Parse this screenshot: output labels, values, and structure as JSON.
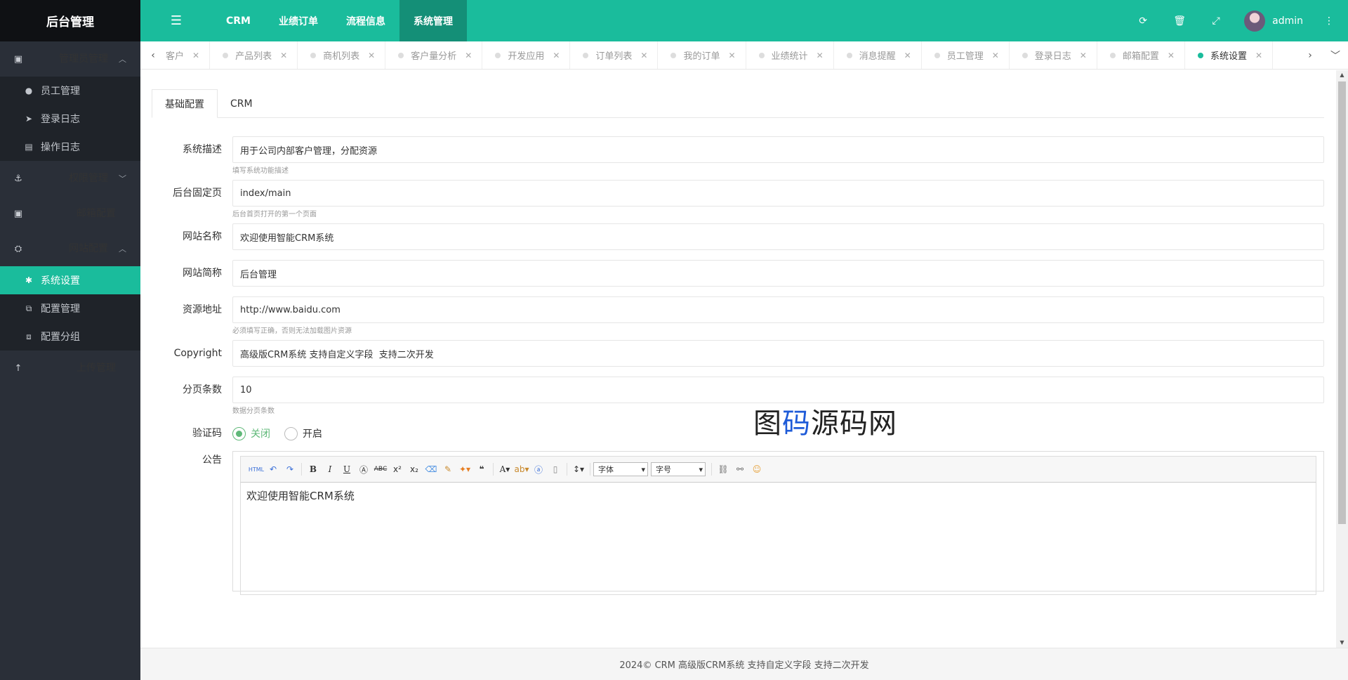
{
  "app": {
    "logo": "后台管理"
  },
  "sidebar": {
    "groups": [
      {
        "label": "管理员管理",
        "icon": "user-badge-icon",
        "expanded": true,
        "items": [
          {
            "label": "员工管理",
            "icon": "person-icon"
          },
          {
            "label": "登录日志",
            "icon": "paper-plane-icon"
          },
          {
            "label": "操作日志",
            "icon": "list-icon"
          }
        ]
      },
      {
        "label": "权限管理",
        "icon": "anchor-icon",
        "expanded": false
      },
      {
        "label": "邮箱配置",
        "icon": "mail-box-icon",
        "expanded": false
      },
      {
        "label": "网站配置",
        "icon": "site-icon",
        "expanded": true,
        "items": [
          {
            "label": "系统设置",
            "icon": "gear-icon",
            "active": true
          },
          {
            "label": "配置管理",
            "icon": "config-icon"
          },
          {
            "label": "配置分组",
            "icon": "group-icon"
          }
        ]
      },
      {
        "label": "上传管理",
        "icon": "upload-arrow-icon",
        "expanded": false
      }
    ]
  },
  "header": {
    "nav": [
      "CRM",
      "业绩订单",
      "流程信息",
      "系统管理"
    ],
    "active_nav": "系统管理",
    "user": "admin"
  },
  "tabs": [
    {
      "label": "客户"
    },
    {
      "label": "产品列表"
    },
    {
      "label": "商机列表"
    },
    {
      "label": "客户量分析"
    },
    {
      "label": "开发应用"
    },
    {
      "label": "订单列表"
    },
    {
      "label": "我的订单"
    },
    {
      "label": "业绩统计"
    },
    {
      "label": "消息提醒"
    },
    {
      "label": "员工管理"
    },
    {
      "label": "登录日志"
    },
    {
      "label": "邮箱配置"
    },
    {
      "label": "系统设置",
      "active": true
    }
  ],
  "content": {
    "tabs": [
      "基础配置",
      "CRM"
    ],
    "form": {
      "desc": {
        "label": "系统描述",
        "value": "用于公司内部客户管理，分配资源",
        "help": "填写系统功能描述"
      },
      "home": {
        "label": "后台固定页",
        "value": "index/main",
        "help": "后台首页打开的第一个页面"
      },
      "site_name": {
        "label": "网站名称",
        "value": "欢迎使用智能CRM系统"
      },
      "site_short": {
        "label": "网站简称",
        "value": "后台管理"
      },
      "resource": {
        "label": "资源地址",
        "value": "http://www.baidu.com",
        "help": "必须填写正确，否则无法加载图片资源"
      },
      "copyright": {
        "label": "Copyright",
        "value": "高级版CRM系统 支持自定义字段  支持二次开发"
      },
      "page_size": {
        "label": "分页条数",
        "value": "10",
        "help": "数据分页条数"
      },
      "captcha": {
        "label": "验证码",
        "options": [
          "关闭",
          "开启"
        ],
        "selected": "关闭"
      },
      "notice": {
        "label": "公告",
        "font_select": "字体",
        "size_select": "字号",
        "body": "欢迎使用智能CRM系统"
      }
    }
  },
  "watermark": {
    "part1": "图",
    "part2": "码",
    "part3": "源码网"
  },
  "footer": "2024© CRM 高级版CRM系统 支持自定义字段 支持二次开发",
  "colors": {
    "accent": "#1abc9c",
    "sidebar": "#2a2f38",
    "radio": "#5fb878"
  }
}
